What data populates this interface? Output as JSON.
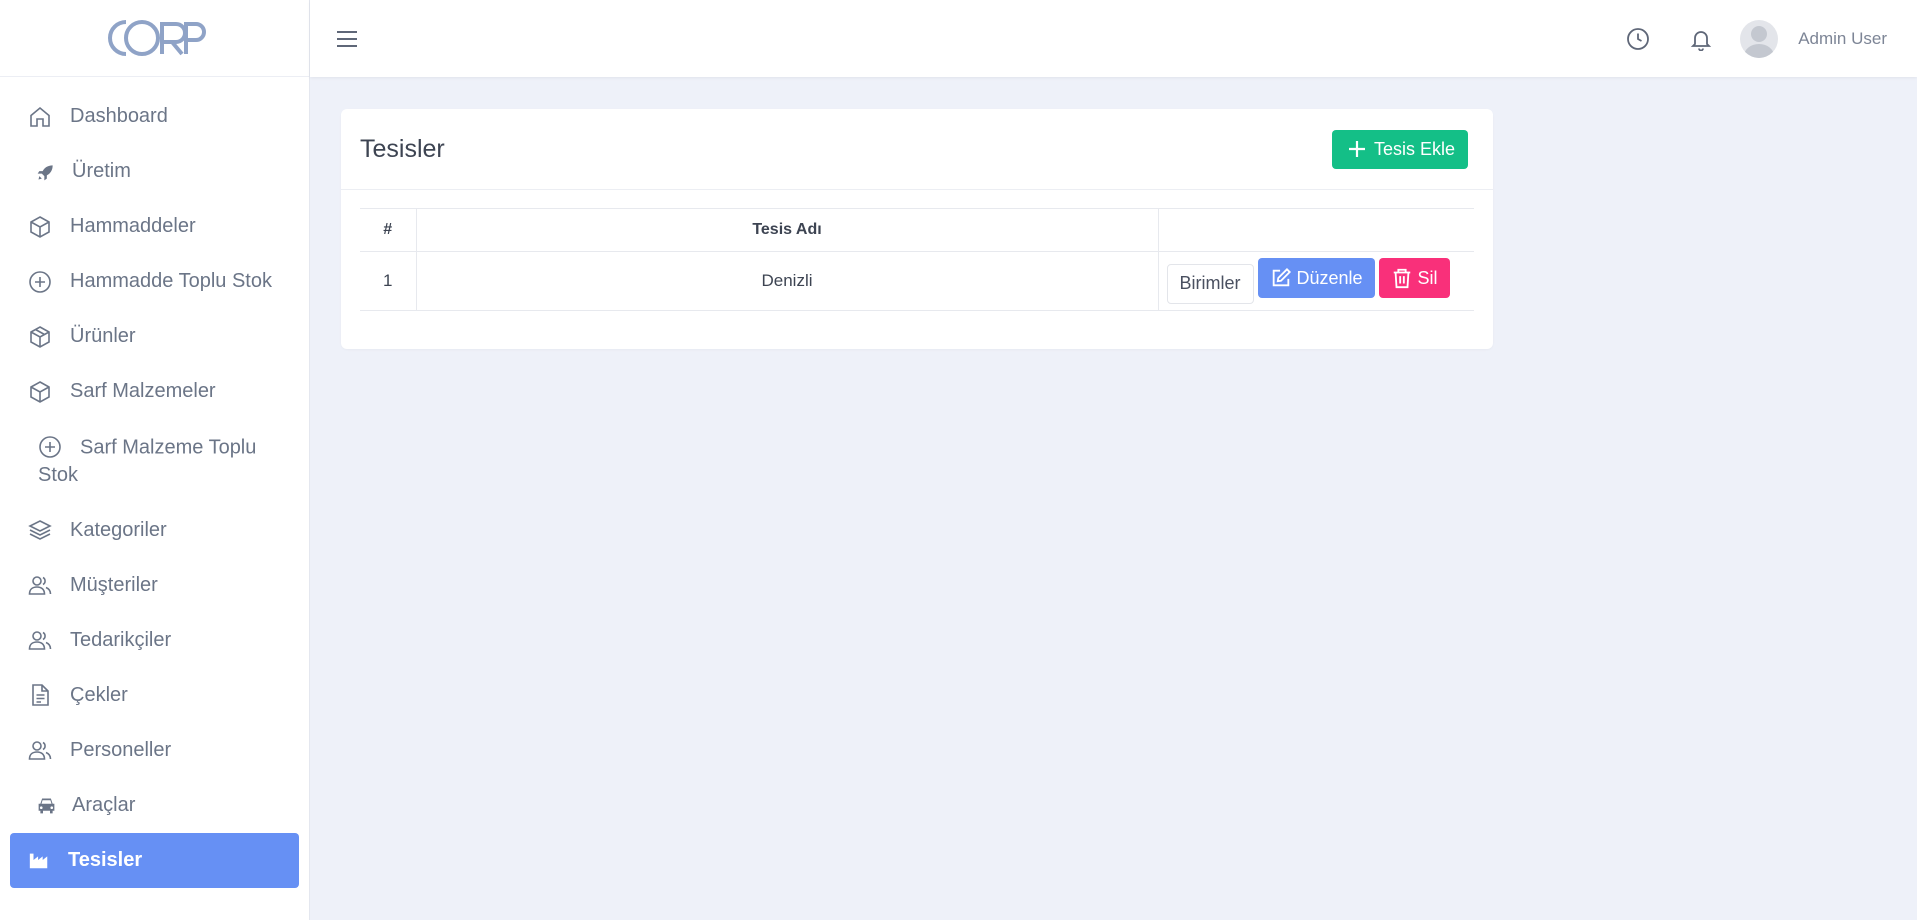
{
  "app": {
    "logo_text": "CORP"
  },
  "sidebar": {
    "items": [
      {
        "label": "Dashboard",
        "icon": "home-icon"
      },
      {
        "label": "Üretim",
        "icon": "rocket-icon"
      },
      {
        "label": "Hammaddeler",
        "icon": "box-icon"
      },
      {
        "label": "Hammadde Toplu Stok",
        "icon": "plus-circle-icon"
      },
      {
        "label": "Ürünler",
        "icon": "box-icon"
      },
      {
        "label": "Sarf Malzemeler",
        "icon": "box-icon"
      },
      {
        "label": "Sarf Malzeme Toplu Stok",
        "icon": "plus-circle-icon"
      },
      {
        "label": "Kategoriler",
        "icon": "layers-icon"
      },
      {
        "label": "Müşteriler",
        "icon": "users-icon"
      },
      {
        "label": "Tedarikçiler",
        "icon": "users-icon"
      },
      {
        "label": "Çekler",
        "icon": "file-text-icon"
      },
      {
        "label": "Personeller",
        "icon": "users-icon"
      },
      {
        "label": "Araçlar",
        "icon": "car-icon"
      },
      {
        "label": "Tesisler",
        "icon": "industry-icon",
        "active": true
      }
    ]
  },
  "header": {
    "user_name": "Admin User"
  },
  "main": {
    "title": "Tesisler",
    "add_button_label": "Tesis Ekle",
    "table": {
      "columns": [
        "#",
        "Tesis Adı",
        ""
      ],
      "rows": [
        {
          "num": "1",
          "name": "Denizli"
        }
      ]
    },
    "row_actions": {
      "units_label": "Birimler",
      "edit_label": "Düzenle",
      "delete_label": "Sil"
    }
  },
  "colors": {
    "primary": "#6690f4",
    "success": "#14bf87",
    "danger": "#f9307a",
    "background": "#eef1f9"
  }
}
